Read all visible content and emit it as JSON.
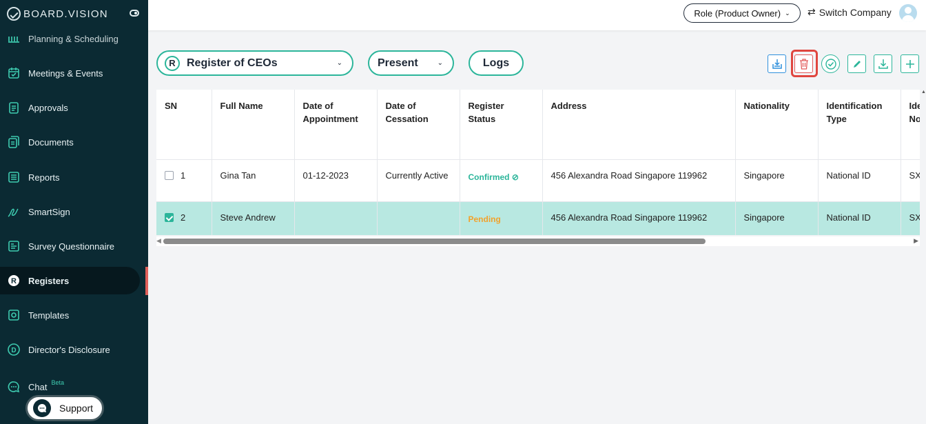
{
  "brand": {
    "name": "BOARD.VISION"
  },
  "sidebar": {
    "partial_item": "Planning & Scheduling",
    "items": [
      {
        "label": "Meetings & Events",
        "icon": "calendar-icon"
      },
      {
        "label": "Approvals",
        "icon": "clipboard-icon"
      },
      {
        "label": "Documents",
        "icon": "documents-icon"
      },
      {
        "label": "Reports",
        "icon": "report-icon"
      },
      {
        "label": "SmartSign",
        "icon": "signature-icon"
      },
      {
        "label": "Survey Questionnaire",
        "icon": "survey-icon"
      },
      {
        "label": "Registers",
        "icon": "registers-icon",
        "active": true
      },
      {
        "label": "Templates",
        "icon": "templates-icon"
      },
      {
        "label": "Director's Disclosure",
        "icon": "disclosure-icon"
      },
      {
        "label": "Chat",
        "icon": "chat-icon",
        "badge": "Beta"
      }
    ],
    "support_label": "Support"
  },
  "header": {
    "role_label": "Role (Product Owner)",
    "switch_company_label": "Switch Company"
  },
  "filters": {
    "register_letter": "R",
    "register_label": "Register of CEOs",
    "period_label": "Present",
    "logs_label": "Logs"
  },
  "toolbar": [
    "import-icon",
    "delete-icon",
    "approve-icon",
    "edit-icon",
    "download-icon",
    "add-icon"
  ],
  "table": {
    "columns": [
      "SN",
      "Full Name",
      "Date of Appointment",
      "Date of Cessation",
      "Register Status",
      "Address",
      "Nationality",
      "Identification Type",
      "Identification No."
    ],
    "header_visible": [
      "SN",
      "Full Name",
      "Date of\nAppointment",
      "Date of\nCessation",
      "Register Status",
      "Address",
      "Nationality",
      "Identification\nType",
      "Ide\nNo."
    ],
    "rows": [
      {
        "sn": "1",
        "full_name": "Gina Tan",
        "date_of_appointment": "01-12-2023",
        "date_of_cessation": "Currently Active",
        "status": "Confirmed",
        "address": "456 Alexandra Road Singapore 119962",
        "nationality": "Singapore",
        "id_type": "National ID",
        "id_no": "SX",
        "checked": false
      },
      {
        "sn": "2",
        "full_name": "Steve Andrew",
        "date_of_appointment": "",
        "date_of_cessation": "",
        "status": "Pending",
        "address": "456 Alexandra Road Singapore 119962",
        "nationality": "Singapore",
        "id_type": "National ID",
        "id_no": "SX",
        "checked": true
      }
    ]
  },
  "colors": {
    "sidebar_bg": "#0b2a33",
    "accent": "#2bb59a",
    "selected_row": "#b8e8e1",
    "pending": "#f2a22b",
    "highlight": "#e0463f"
  }
}
